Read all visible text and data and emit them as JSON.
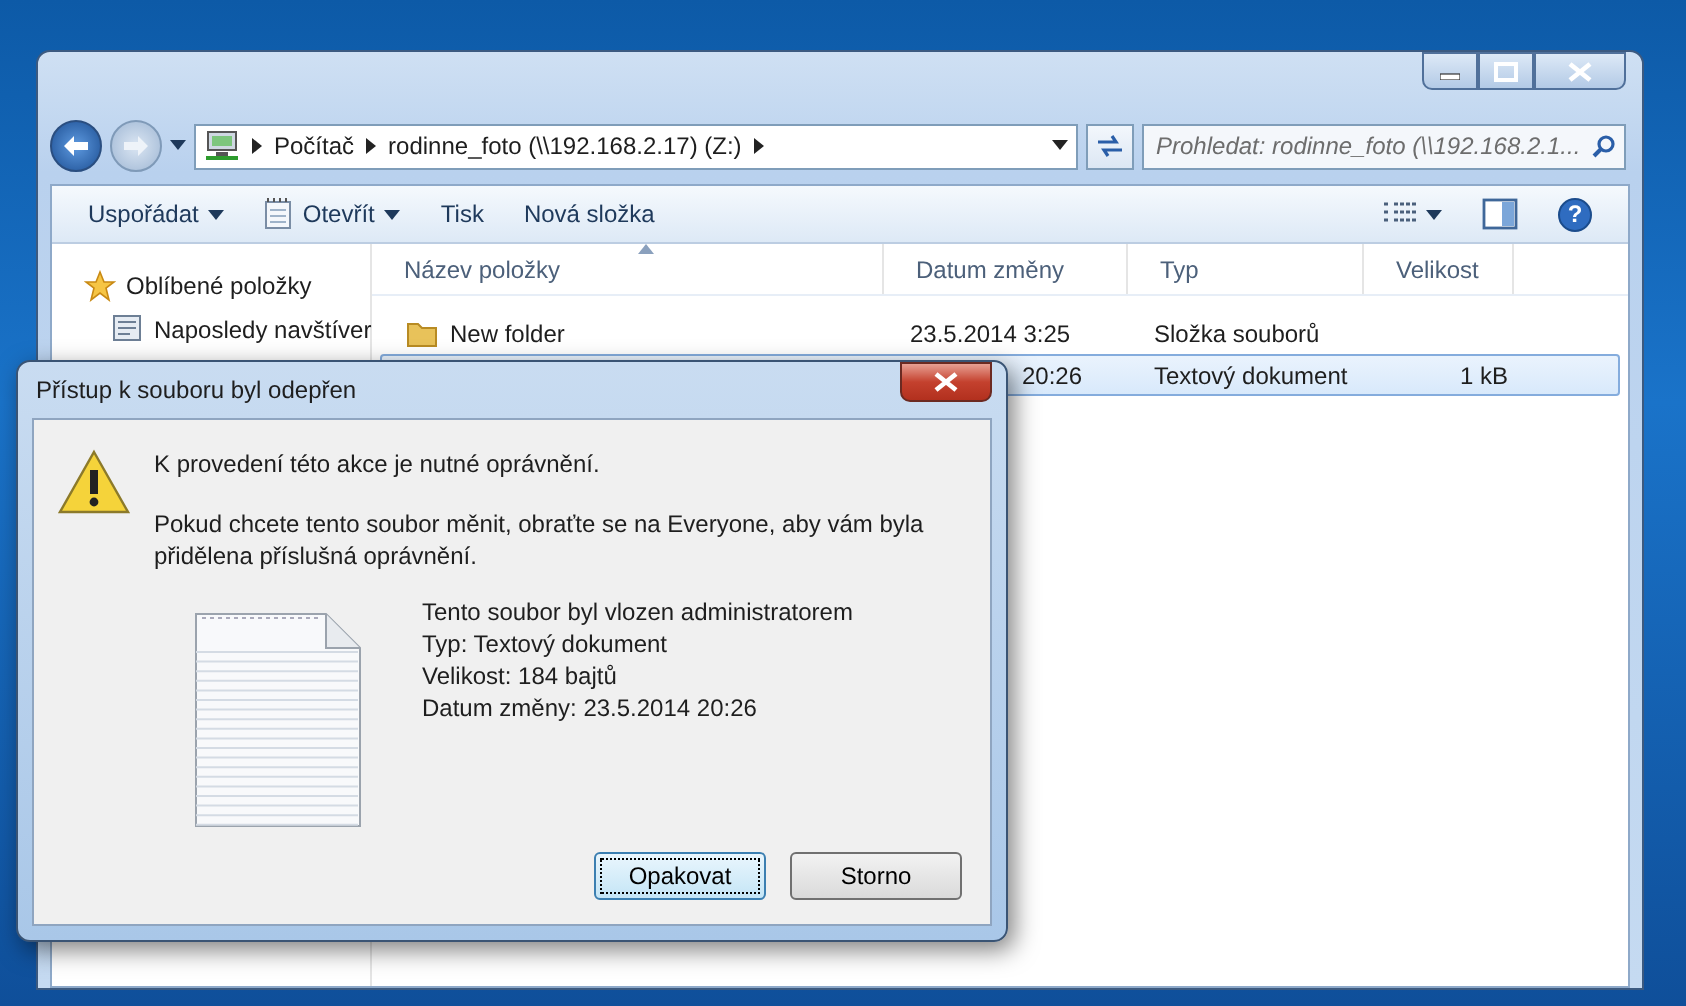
{
  "explorer": {
    "address": {
      "crumbs": [
        "Počítač",
        "rodinne_foto (\\\\192.168.2.17) (Z:)"
      ]
    },
    "search": {
      "placeholder": "Prohledat: rodinne_foto (\\\\192.168.2.1..."
    },
    "help": {
      "label": "?"
    },
    "toolbar": [
      {
        "label": "Uspořádat",
        "dropdown": true,
        "kind": "plain"
      },
      {
        "label": "Otevřít",
        "dropdown": true,
        "kind": "open"
      },
      {
        "label": "Tisk",
        "dropdown": false,
        "kind": "plain"
      },
      {
        "label": "Nová složka",
        "dropdown": false,
        "kind": "plain"
      }
    ],
    "sidebar": {
      "items": [
        {
          "label": "Oblíbené položky",
          "kind": "favorites"
        },
        {
          "label": "Naposledy navštíver",
          "kind": "recent"
        }
      ]
    },
    "table": {
      "columns": [
        {
          "label": "Název položky",
          "sorted": true
        },
        {
          "label": "Datum změny",
          "sorted": false
        },
        {
          "label": "Typ",
          "sorted": false
        },
        {
          "label": "Velikost",
          "sorted": false
        }
      ],
      "rows": [
        {
          "kind": "folder",
          "name": "New folder",
          "date": "23.5.2014 3:25",
          "type": "Složka souborů",
          "selected": false
        },
        {
          "kind": "hidden",
          "date": "20:26",
          "type": "Textový dokument",
          "size": "1 kB",
          "selected": true
        }
      ]
    }
  },
  "dialog": {
    "title": "Přístup k souboru byl odepřen",
    "heading": "K provedení této akce je nutné oprávnění.",
    "message": "Pokud chcete tento soubor měnit, obraťte se na Everyone, aby vám byla přidělena příslušná oprávnění.",
    "details": [
      "Tento soubor byl vlozen administratorem",
      "Typ: Textový dokument",
      "Velikost: 184 bajtů",
      "Datum změny: 23.5.2014 20:26"
    ],
    "buttons": [
      {
        "label": "Opakovat",
        "default": true
      },
      {
        "label": "Storno",
        "default": false
      }
    ]
  }
}
